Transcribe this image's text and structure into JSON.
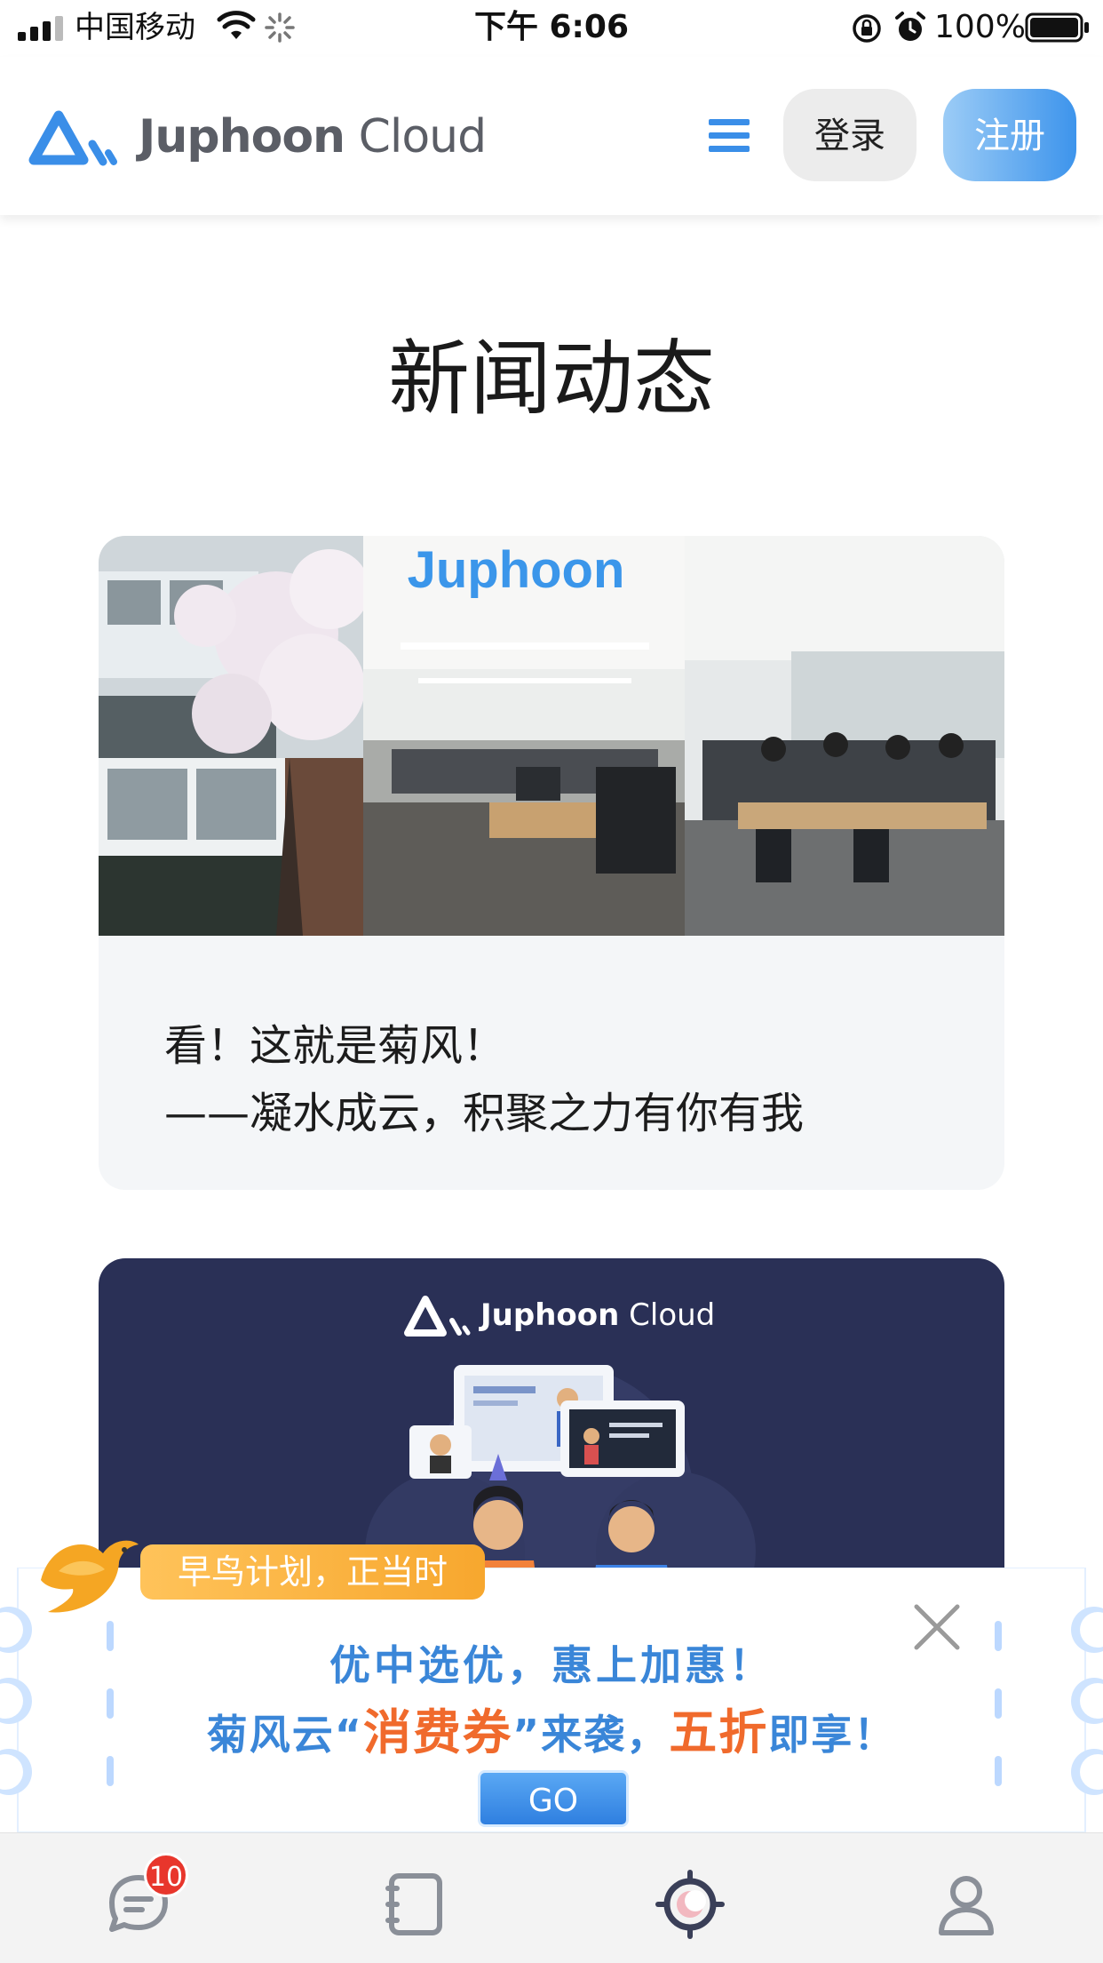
{
  "status_bar": {
    "carrier": "中国移动",
    "time": "下午 6:06",
    "battery": "100%"
  },
  "header": {
    "logo_bold": "Juphoon",
    "logo_light": " Cloud",
    "login_label": "登录",
    "register_label": "注册",
    "brand_color": "#3d94ec"
  },
  "page": {
    "title": "新闻动态"
  },
  "news": [
    {
      "title_line1": "看！这就是菊风！",
      "title_line2": "——凝水成云，积聚之力有你有我",
      "image_watermark": "Juphoon"
    },
    {
      "logo_bold": "Juphoon",
      "logo_light": " Cloud"
    }
  ],
  "promo": {
    "tag": "早鸟计划，正当时",
    "line1": "优中选优，惠上加惠！",
    "line2_a": "菊风云“",
    "line2_hl1": "消费券",
    "line2_b": "”来袭，",
    "line2_hl2": "五折",
    "line2_c": "即享！",
    "go_label": "GO"
  },
  "tabbar": {
    "messages_badge": "10",
    "items": [
      "message-icon",
      "notebook-icon",
      "discover-icon",
      "profile-icon"
    ],
    "active": "discover-icon"
  }
}
